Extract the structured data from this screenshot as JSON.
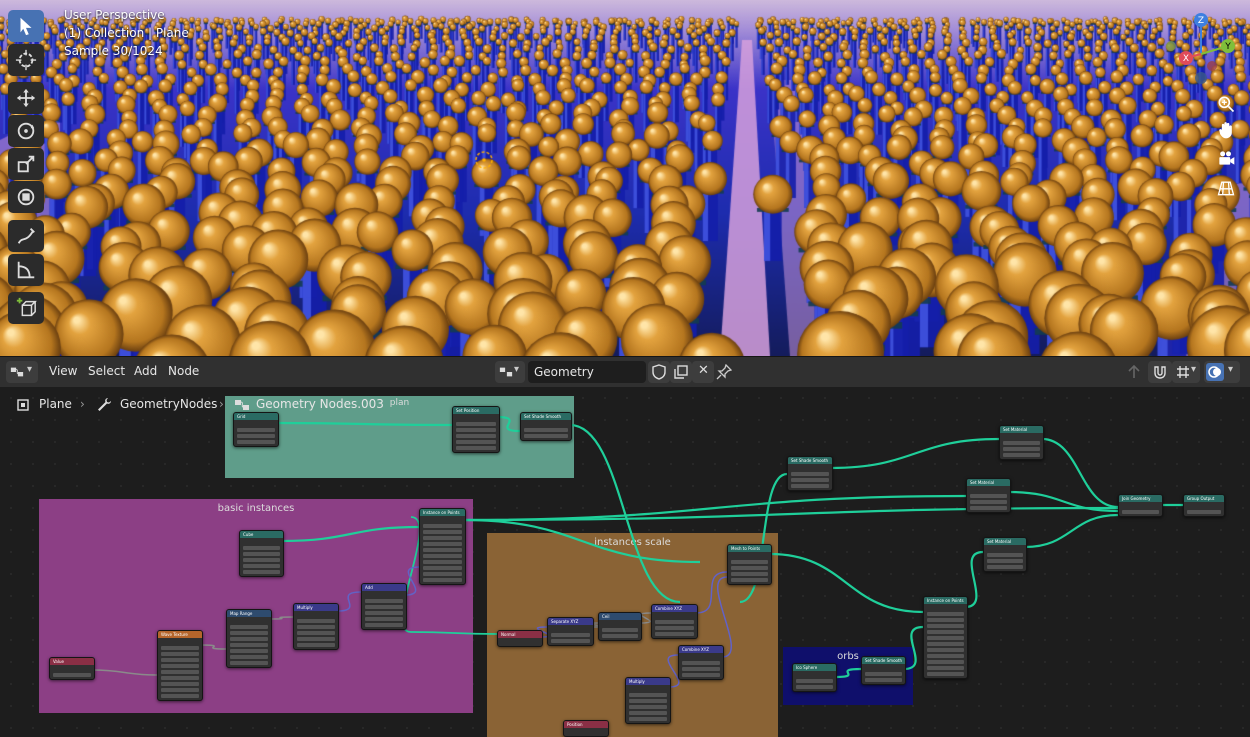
{
  "viewport": {
    "info_lines": [
      "User Perspective",
      "(1) Collection | Plane",
      "Sample 30/1024"
    ],
    "toolbar": [
      {
        "name": "select-box-tool",
        "icon": "cursor-arrow-icon",
        "active": true
      },
      {
        "name": "cursor-tool",
        "icon": "crosshair-cursor-icon",
        "active": false
      },
      {
        "name": "move-tool",
        "icon": "move-arrows-icon",
        "active": false
      },
      {
        "name": "rotate-tool",
        "icon": "rotate-icon",
        "active": false
      },
      {
        "name": "scale-tool",
        "icon": "scale-icon",
        "active": false
      },
      {
        "name": "transform-tool",
        "icon": "transform-icon",
        "active": false
      },
      {
        "name": "annotate-tool",
        "icon": "pencil-icon",
        "active": false
      },
      {
        "name": "measure-tool",
        "icon": "ruler-icon",
        "active": false
      },
      {
        "name": "add-cube-tool",
        "icon": "add-cube-icon",
        "active": false
      }
    ],
    "gizmo": {
      "x_label": "X",
      "y_label": "Y",
      "z_label": "Z",
      "colors": {
        "x": "#e04b59",
        "y": "#7fbf3a",
        "z": "#3d7fe0"
      }
    },
    "nav_icons": [
      "zoom-icon",
      "hand-pan-icon",
      "camera-icon",
      "grid-icon"
    ]
  },
  "node_header": {
    "menus": [
      "View",
      "Select",
      "Add",
      "Node"
    ],
    "tree_name": "Geometry Nodes.003"
  },
  "breadcrumb": {
    "object": "Plane",
    "modifier": "GeometryNodes"
  },
  "frames": {
    "top_title": "Geometry Nodes.003",
    "plan": "plan",
    "basic": "basic instances",
    "scale": "instances scale",
    "orbs": "orbs"
  },
  "colors": {
    "plan_frame": "#5f9d8a",
    "basic_frame": "#8c3f85",
    "scale_frame": "#8a6335",
    "orbs_frame": "#0f0f6b",
    "geometry_wire": "#1fcf9a",
    "gray_wire": "#8a8a8a",
    "vector_wire": "#6262c6",
    "mesh_header": "#2a6b63",
    "geometry_header": "#2a6b63",
    "instance_header": "#2a6b63",
    "vector_header": "#3a3a8a",
    "texture_header": "#b5652b",
    "input_header": "#8a2f45",
    "math_header": "#2e4b6e"
  },
  "nodes": [
    {
      "id": "grid",
      "title": "Grid",
      "hc": "mesh_header",
      "rows": 4
    },
    {
      "id": "setpos",
      "title": "Set Position",
      "hc": "geometry_header",
      "rows": 6
    },
    {
      "id": "setsmooth1",
      "title": "Set Shade Smooth",
      "hc": "geometry_header",
      "rows": 3
    },
    {
      "id": "cube",
      "title": "Cube",
      "hc": "mesh_header",
      "rows": 6
    },
    {
      "id": "inst1",
      "title": "Instance on Points",
      "hc": "instance_header",
      "rows": 11
    },
    {
      "id": "value",
      "title": "Value",
      "hc": "input_header",
      "rows": 2
    },
    {
      "id": "wavetex",
      "title": "Wave Texture",
      "hc": "texture_header",
      "rows": 10
    },
    {
      "id": "maprange",
      "title": "Map Range",
      "hc": "math_header",
      "rows": 8
    },
    {
      "id": "multiply1",
      "title": "Multiply",
      "hc": "vector_header",
      "rows": 6
    },
    {
      "id": "add",
      "title": "Add",
      "hc": "vector_header",
      "rows": 6
    },
    {
      "id": "normal",
      "title": "Normal",
      "hc": "input_header",
      "rows": 1
    },
    {
      "id": "separate",
      "title": "Separate XYZ",
      "hc": "vector_header",
      "rows": 3
    },
    {
      "id": "ceil",
      "title": "Ceil",
      "hc": "math_header",
      "rows": 3
    },
    {
      "id": "combine1",
      "title": "Combine XYZ",
      "hc": "vector_header",
      "rows": 4
    },
    {
      "id": "combine2",
      "title": "Combine XYZ",
      "hc": "vector_header",
      "rows": 4
    },
    {
      "id": "multiply2",
      "title": "Multiply",
      "hc": "vector_header",
      "rows": 6
    },
    {
      "id": "position",
      "title": "Position",
      "hc": "input_header",
      "rows": 1
    },
    {
      "id": "meshtopts",
      "title": "Mesh to Points",
      "hc": "geometry_header",
      "rows": 5
    },
    {
      "id": "setsmooth2",
      "title": "Set Shade Smooth",
      "hc": "geometry_header",
      "rows": 4
    },
    {
      "id": "setmat1",
      "title": "Set Material",
      "hc": "geometry_header",
      "rows": 4
    },
    {
      "id": "setmat2",
      "title": "Set Material",
      "hc": "geometry_header",
      "rows": 4
    },
    {
      "id": "setmat3",
      "title": "Set Material",
      "hc": "geometry_header",
      "rows": 4
    },
    {
      "id": "joingeo",
      "title": "Join Geometry",
      "hc": "geometry_header",
      "rows": 2
    },
    {
      "id": "groupout",
      "title": "Group Output",
      "hc": "geometry_header",
      "rows": 2
    },
    {
      "id": "inst2",
      "title": "Instance on Points",
      "hc": "instance_header",
      "rows": 12
    },
    {
      "id": "icosphere",
      "title": "Ico Sphere",
      "hc": "mesh_header",
      "rows": 3
    },
    {
      "id": "setsmooth3",
      "title": "Set Shade Smooth",
      "hc": "geometry_header",
      "rows": 3
    }
  ]
}
